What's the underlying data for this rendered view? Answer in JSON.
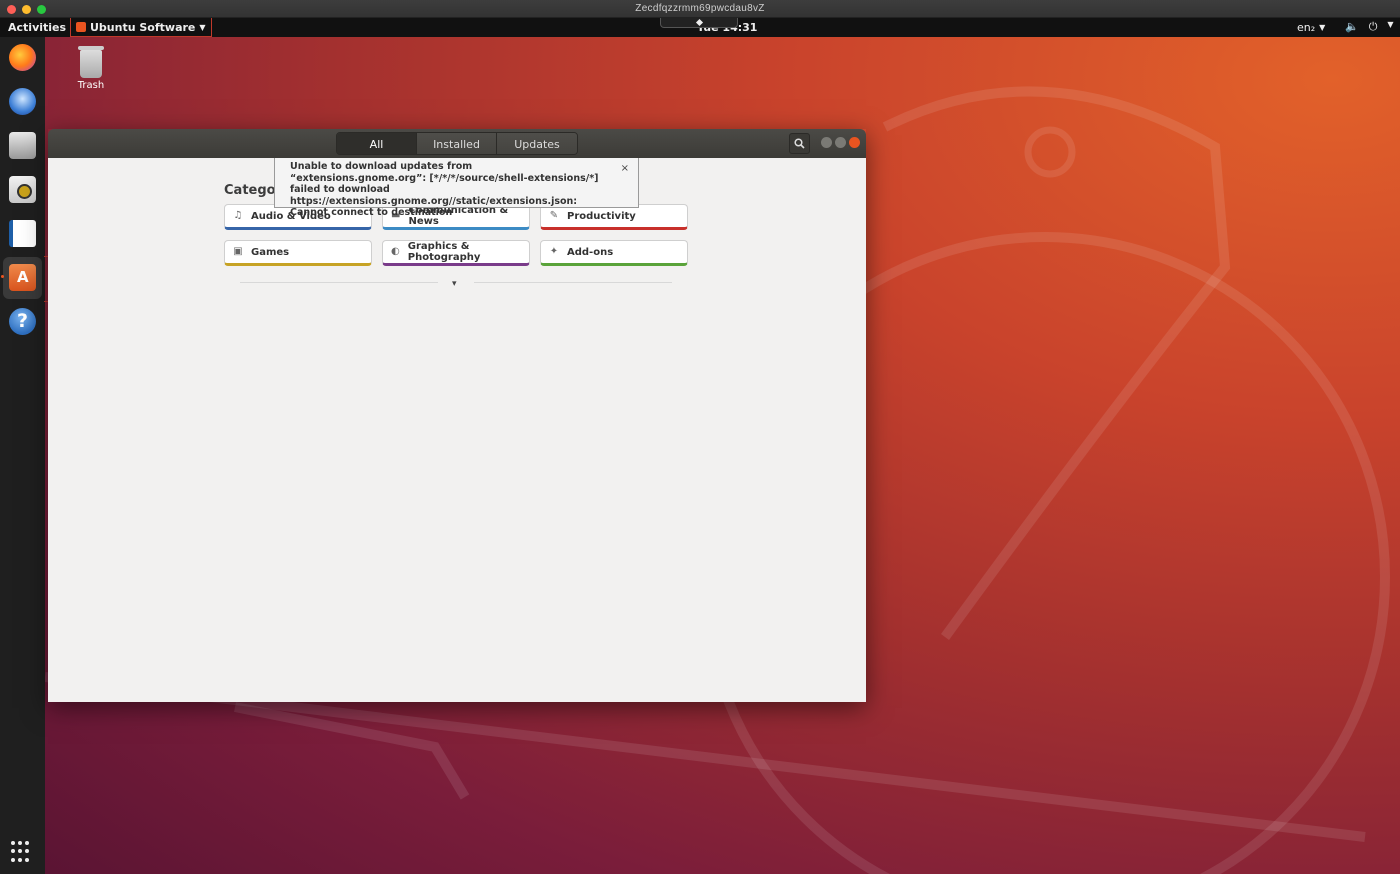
{
  "host": {
    "title": "Zecdfqzzrmm69pwcdau8vZ"
  },
  "topbar": {
    "activities": "Activities",
    "app_menu": "Ubuntu Software",
    "clock": "Tue 14:31",
    "language": "en₂",
    "volume_icon": "🔈",
    "power_icon": "⏻"
  },
  "desktop": {
    "trash_label": "Trash"
  },
  "dock": {
    "items": [
      "firefox-icon",
      "thunderbird-icon",
      "files-icon",
      "rhythmbox-icon",
      "libreoffice-writer-icon",
      "ubuntu-software-icon",
      "help-icon"
    ],
    "active": "ubuntu-software-icon"
  },
  "window": {
    "tabs": [
      {
        "label": "All",
        "active": true
      },
      {
        "label": "Installed",
        "active": false
      },
      {
        "label": "Updates",
        "active": false
      }
    ],
    "categories_title": "Categories",
    "categories": [
      {
        "label": "Audio & Video",
        "icon": "♫",
        "color": "#3665a8"
      },
      {
        "label": "Communication & News",
        "icon": "▬",
        "color": "#3c8bc4"
      },
      {
        "label": "Productivity",
        "icon": "✎",
        "color": "#c8302b"
      },
      {
        "label": "Games",
        "icon": "▣",
        "color": "#c7a325"
      },
      {
        "label": "Graphics & Photography",
        "icon": "◐",
        "color": "#7a3b8a"
      },
      {
        "label": "Add-ons",
        "icon": "✦",
        "color": "#5aa33a"
      }
    ],
    "expander_arrow": "▾",
    "notification": {
      "text": "Unable to download updates from “extensions.gnome.org”: [*/*/*/source/shell-extensions/*] failed to download https://extensions.gnome.org//static/extensions.json: Cannot connect to destination",
      "close": "×"
    }
  }
}
